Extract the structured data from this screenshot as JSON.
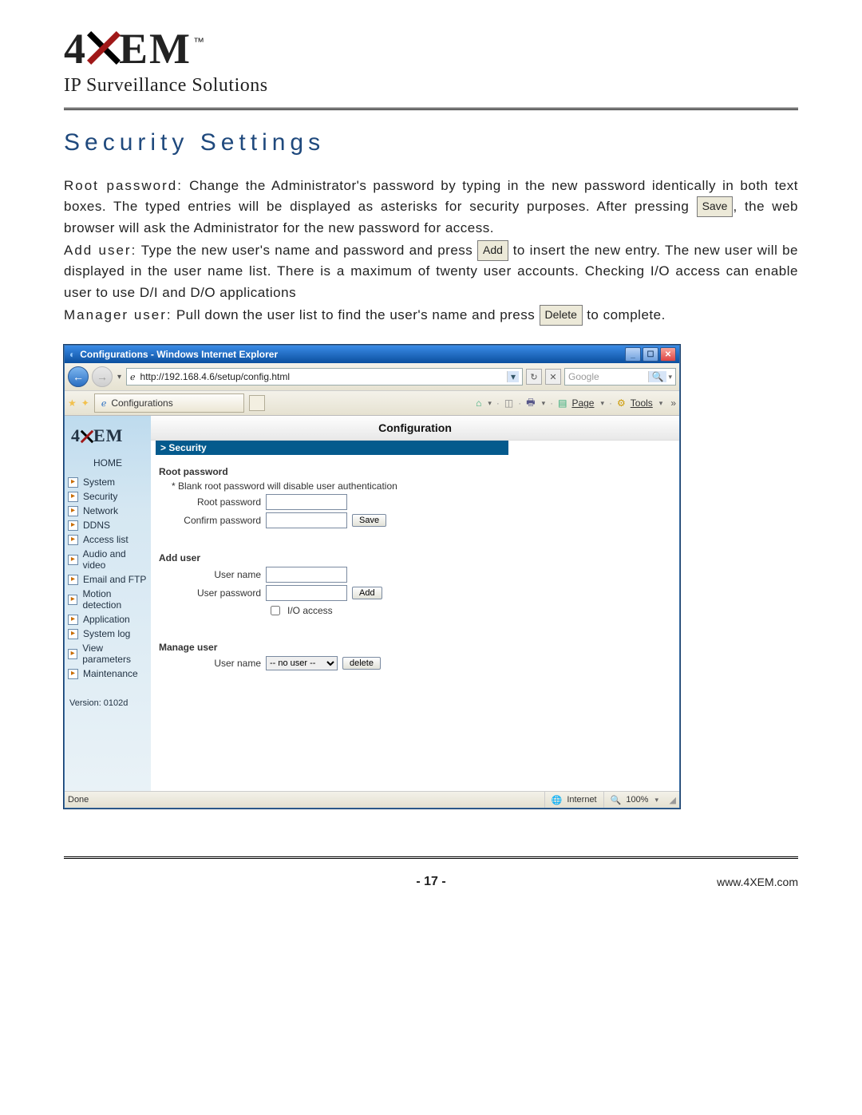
{
  "brand": {
    "name_before_x": "4",
    "name_after_x": "EM",
    "tm": "™",
    "tagline": "IP Surveillance Solutions"
  },
  "heading": "Security Settings",
  "para1_lead": "Root password:",
  "para1_rest": " Change the Administrator's password by typing in the new password identically in both text boxes. The typed entries will be displayed as asterisks for security purposes. After pressing ",
  "para1_btn": "Save",
  "para1_tail": ", the web browser will ask the Administrator for the new password for access.",
  "para2_lead": "Add user:",
  "para2_rest": " Type the new user's name and password and press ",
  "para2_btn": "Add",
  "para2_tail": " to insert the new entry. The new user will be displayed in the user name list. There is a maximum of twenty user accounts. Checking I/O access can enable user to use D/I and D/O applications",
  "para3_lead": "Manager user:",
  "para3_rest": " Pull down the user list to find the user's name and press ",
  "para3_btn": "Delete",
  "para3_tail": " to complete.",
  "ie": {
    "title": "Configurations - Windows Internet Explorer",
    "url": "http://192.168.4.6/setup/config.html",
    "refresh_lbl": "↻",
    "search_placeholder": "Google",
    "tab": "Configurations",
    "tool_page": "Page",
    "tool_tools": "Tools",
    "cfg_title": "Configuration",
    "crumb": "> Security",
    "home": "HOME",
    "side": [
      "System",
      "Security",
      "Network",
      "DDNS",
      "Access list",
      "Audio and video",
      "Email and FTP",
      "Motion detection",
      "Application",
      "System log",
      "View parameters",
      "Maintenance"
    ],
    "version": "Version: 0102d",
    "sec_root": "Root password",
    "note": "* Blank root password will disable user authentication",
    "lbl_root": "Root password",
    "lbl_confirm": "Confirm password",
    "btn_save": "Save",
    "sec_add": "Add user",
    "lbl_uname": "User name",
    "lbl_upass": "User password",
    "btn_add": "Add",
    "chk_io": "I/O access",
    "sec_manage": "Manage user",
    "lbl_uname2": "User name",
    "sel_nouser": "-- no user --",
    "btn_delete": "delete",
    "status_done": "Done",
    "status_zone": "Internet",
    "status_zoom": "100%"
  },
  "footer": {
    "page": "- 17 -",
    "url": "www.4XEM.com"
  }
}
